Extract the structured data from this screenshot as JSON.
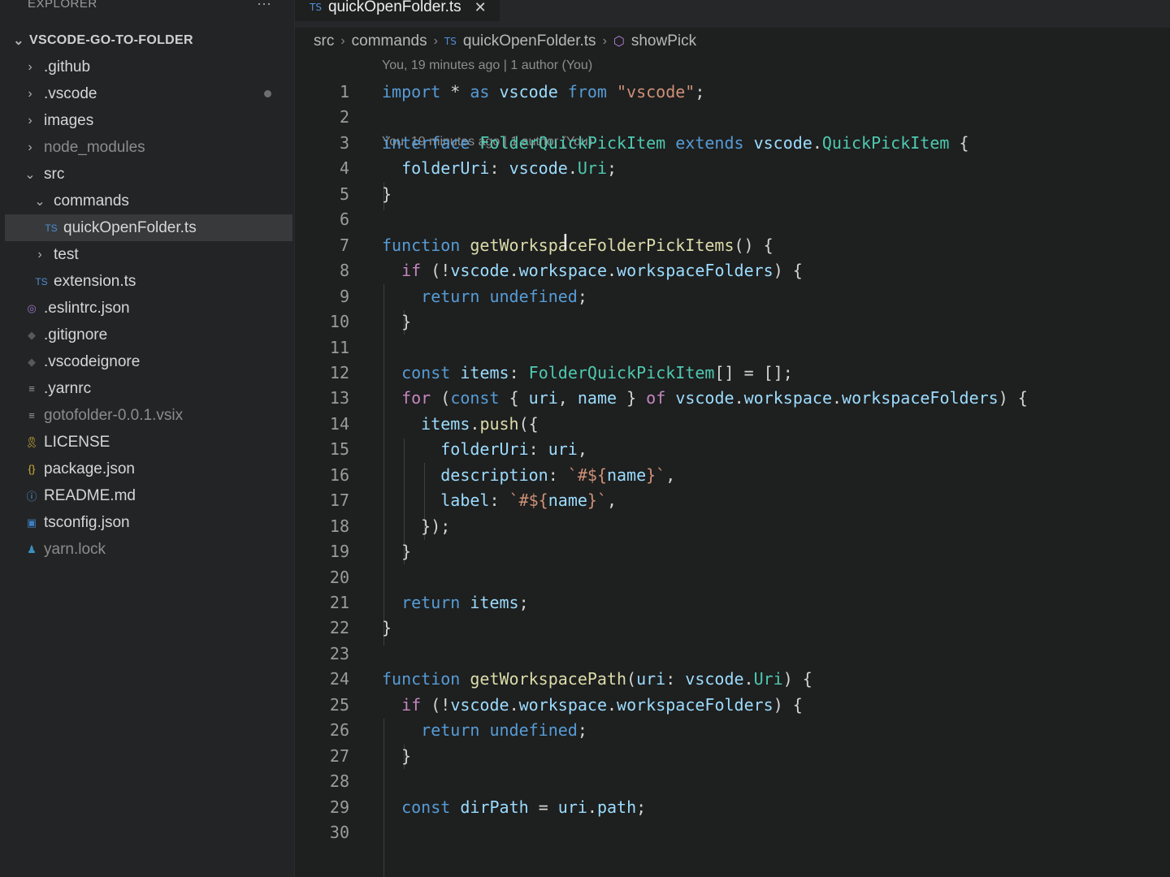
{
  "explorer": {
    "header": "EXPLORER",
    "more_label": "···",
    "root_label": "VSCODE-GO-TO-FOLDER",
    "items": [
      {
        "label": ".github",
        "chevron": ">",
        "icon": "folder-icon"
      },
      {
        "label": ".vscode",
        "chevron": ">",
        "icon": "folder-icon",
        "modified": true
      },
      {
        "label": "images",
        "chevron": ">",
        "icon": "folder-icon"
      },
      {
        "label": "node_modules",
        "chevron": ">",
        "icon": "folder-icon",
        "dim": true
      },
      {
        "label": "src",
        "chevron": "v",
        "icon": "folder-icon"
      },
      {
        "label": "commands",
        "chevron": "v",
        "icon": "folder-icon"
      },
      {
        "label": "quickOpenFolder.ts",
        "icon_text": "TS",
        "icon": "typescript-icon",
        "selected": true
      },
      {
        "label": "test",
        "chevron": ">",
        "icon": "folder-icon"
      },
      {
        "label": "extension.ts",
        "icon_text": "TS",
        "icon": "typescript-icon"
      },
      {
        "label": ".eslintrc.json",
        "icon": "eslint-icon"
      },
      {
        "label": ".gitignore",
        "icon": "git-icon"
      },
      {
        "label": ".vscodeignore",
        "icon": "ignore-icon"
      },
      {
        "label": ".yarnrc",
        "icon": "lines-icon"
      },
      {
        "label": "gotofolder-0.0.1.vsix",
        "icon": "lines-icon",
        "dim": true
      },
      {
        "label": "LICENSE",
        "icon": "license-icon"
      },
      {
        "label": "package.json",
        "icon": "json-icon"
      },
      {
        "label": "README.md",
        "icon": "info-icon"
      },
      {
        "label": "tsconfig.json",
        "icon": "tsconfig-icon"
      },
      {
        "label": "yarn.lock",
        "icon": "yarn-icon",
        "dim": true
      }
    ]
  },
  "editor": {
    "tab_icon_text": "TS",
    "tab_label": "quickOpenFolder.ts",
    "tab_close": "✕",
    "breadcrumb": {
      "src": "src",
      "commands": "commands",
      "file_icon_text": "TS",
      "file": "quickOpenFolder.ts",
      "symbol": "showPick"
    },
    "codelens_1": "You, 19 minutes ago | 1 author (You)",
    "codelens_2": "You, 19 minutes ago | 1 author (You)",
    "lines": [
      {
        "n": "1"
      },
      {
        "n": "2"
      },
      {
        "n": "3"
      },
      {
        "n": "4"
      },
      {
        "n": "5"
      },
      {
        "n": "6"
      },
      {
        "n": "7"
      },
      {
        "n": "8"
      },
      {
        "n": "9"
      },
      {
        "n": "10"
      },
      {
        "n": "11"
      },
      {
        "n": "12"
      },
      {
        "n": "13"
      },
      {
        "n": "14"
      },
      {
        "n": "15"
      },
      {
        "n": "16"
      },
      {
        "n": "17"
      },
      {
        "n": "18"
      },
      {
        "n": "19"
      },
      {
        "n": "20"
      },
      {
        "n": "21"
      },
      {
        "n": "22"
      },
      {
        "n": "23"
      },
      {
        "n": "24"
      },
      {
        "n": "25"
      },
      {
        "n": "26"
      },
      {
        "n": "27"
      },
      {
        "n": "28"
      },
      {
        "n": "29"
      },
      {
        "n": "30"
      }
    ],
    "tokens": {
      "l1": [
        "import",
        " * ",
        "as",
        " vscode ",
        "from",
        " \"vscode\"",
        ";"
      ],
      "l3": [
        "interface",
        " ",
        "FolderQuickPickItem",
        " ",
        "extends",
        " ",
        "vscode",
        ".",
        "QuickPickItem",
        " {"
      ],
      "l4": [
        "  ",
        "folderUri",
        ": ",
        "vscode",
        ".",
        "Uri",
        ";"
      ],
      "l5": [
        "}"
      ],
      "l7": [
        "function",
        " ",
        "getWorkspaceFolderPickItems",
        "() {"
      ],
      "l8": [
        "  ",
        "if",
        " (!",
        "vscode",
        ".",
        "workspace",
        ".",
        "workspaceFolders",
        ") {"
      ],
      "l9": [
        "    ",
        "return",
        " ",
        "undefined",
        ";"
      ],
      "l10": [
        "  }"
      ],
      "l12": [
        "  ",
        "const",
        " ",
        "items",
        ": ",
        "FolderQuickPickItem",
        "[] = [];"
      ],
      "l13": [
        "  ",
        "for",
        " (",
        "const",
        " { ",
        "uri",
        ", ",
        "name",
        " } ",
        "of",
        " ",
        "vscode",
        ".",
        "workspace",
        ".",
        "workspaceFolders",
        ") {"
      ],
      "l14": [
        "    ",
        "items",
        ".",
        "push",
        "({"
      ],
      "l15": [
        "      ",
        "folderUri",
        ": ",
        "uri",
        ","
      ],
      "l16": [
        "      ",
        "description",
        ": ",
        "`#${",
        "name",
        "}`",
        ","
      ],
      "l17": [
        "      ",
        "label",
        ": ",
        "`#${",
        "name",
        "}`",
        ","
      ],
      "l18": [
        "    });"
      ],
      "l19": [
        "  }"
      ],
      "l21": [
        "  ",
        "return",
        " ",
        "items",
        ";"
      ],
      "l22": [
        "}"
      ],
      "l24": [
        "function",
        " ",
        "getWorkspacePath",
        "(",
        "uri",
        ": ",
        "vscode",
        ".",
        "Uri",
        ") {"
      ],
      "l25": [
        "  ",
        "if",
        " (!",
        "vscode",
        ".",
        "workspace",
        ".",
        "workspaceFolders",
        ") {"
      ],
      "l26": [
        "    ",
        "return",
        " ",
        "undefined",
        ";"
      ],
      "l27": [
        "  }"
      ],
      "l29": [
        "  ",
        "const",
        " ",
        "dirPath",
        " = ",
        "uri",
        ".",
        "path",
        ";"
      ]
    },
    "cursor_glyph": "I"
  }
}
